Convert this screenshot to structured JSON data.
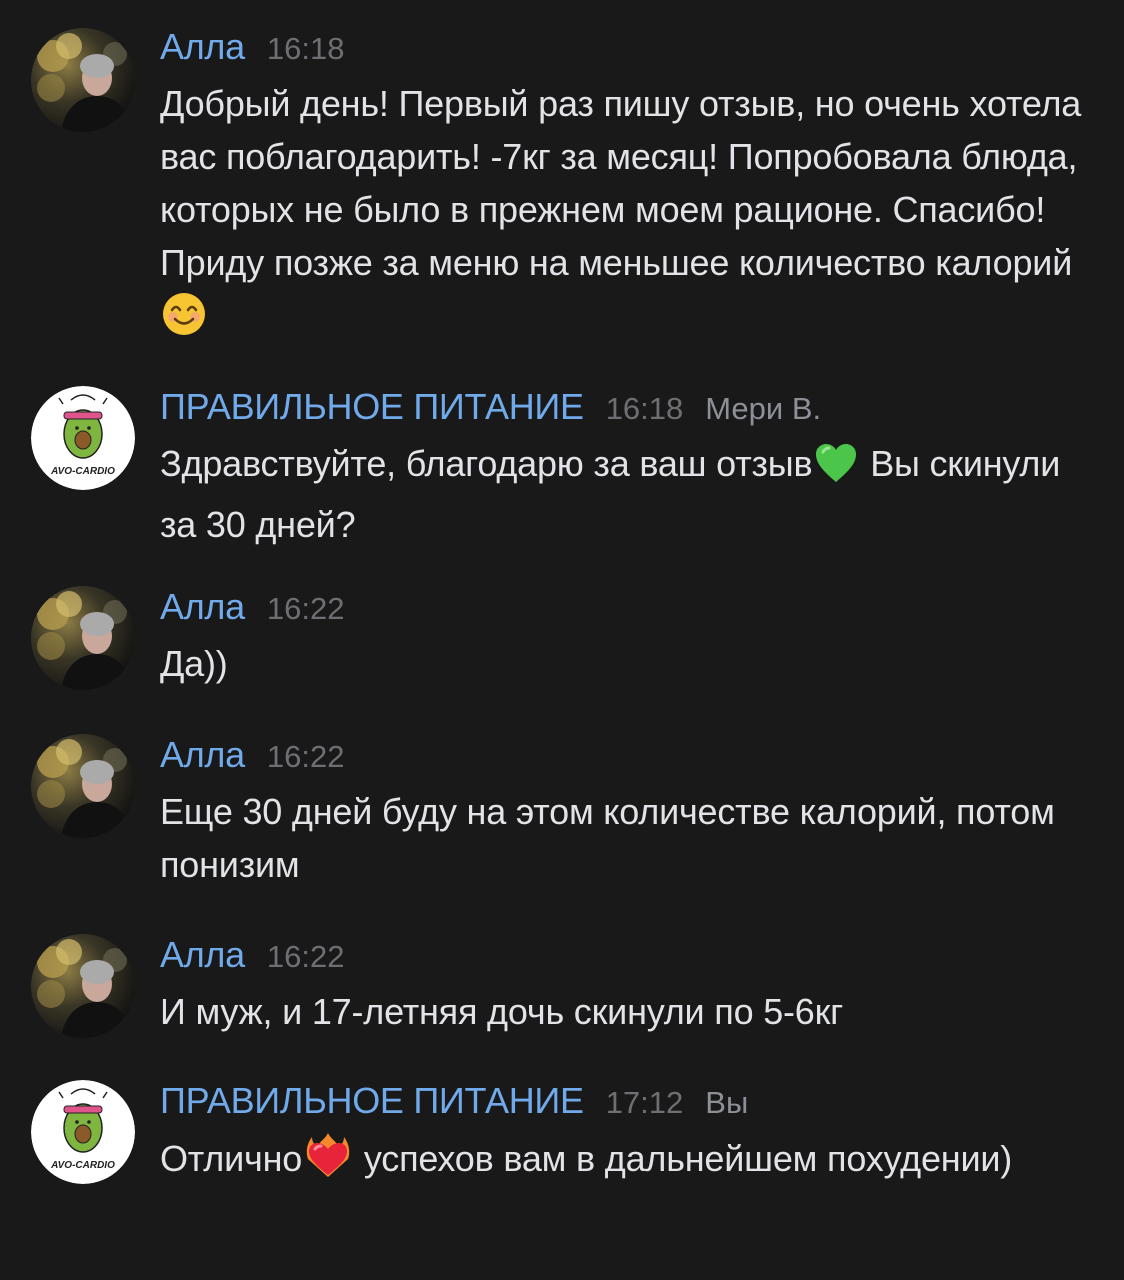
{
  "messages": [
    {
      "author": "Алла",
      "time": "16:18",
      "text": "Добрый день! Первый раз пишу отзыв, но очень хотела вас поблагодарить! -7кг за месяц! Попробовала блюда, которых не было в прежнем моем рационе. Спасибо! Приду позже за меню на меньшее количество калорий",
      "emoji": "smiling-face-emoji"
    },
    {
      "author": "ПРАВИЛЬНОЕ ПИТАНИЕ",
      "time": "16:18",
      "sender": "Мери В.",
      "text_before": "Здравствуйте, благодарю за ваш отзыв",
      "text_after": " Вы скинули за 30 дней?",
      "emoji": "green-heart-emoji",
      "avatar_logo_text": "AVO-CARDIO"
    },
    {
      "author": "Алла",
      "time": "16:22",
      "text": "Да))"
    },
    {
      "author": "Алла",
      "time": "16:22",
      "text": "Еще 30 дней буду на этом количестве калорий, потом понизим"
    },
    {
      "author": "Алла",
      "time": "16:22",
      "text": "И муж, и 17-летняя дочь скинули по 5-6кг"
    },
    {
      "author": "ПРАВИЛЬНОЕ ПИТАНИЕ",
      "time": "17:12",
      "sender": "Вы",
      "text_before": "Отлично",
      "text_after": " успехов вам в дальнейшем похудении)",
      "emoji": "heart-on-fire-emoji",
      "avatar_logo_text": "AVO-CARDIO"
    }
  ],
  "colors": {
    "background": "#19191a",
    "author": "#71aaeb",
    "text": "#e2e3e6",
    "time": "#6d6f73"
  }
}
